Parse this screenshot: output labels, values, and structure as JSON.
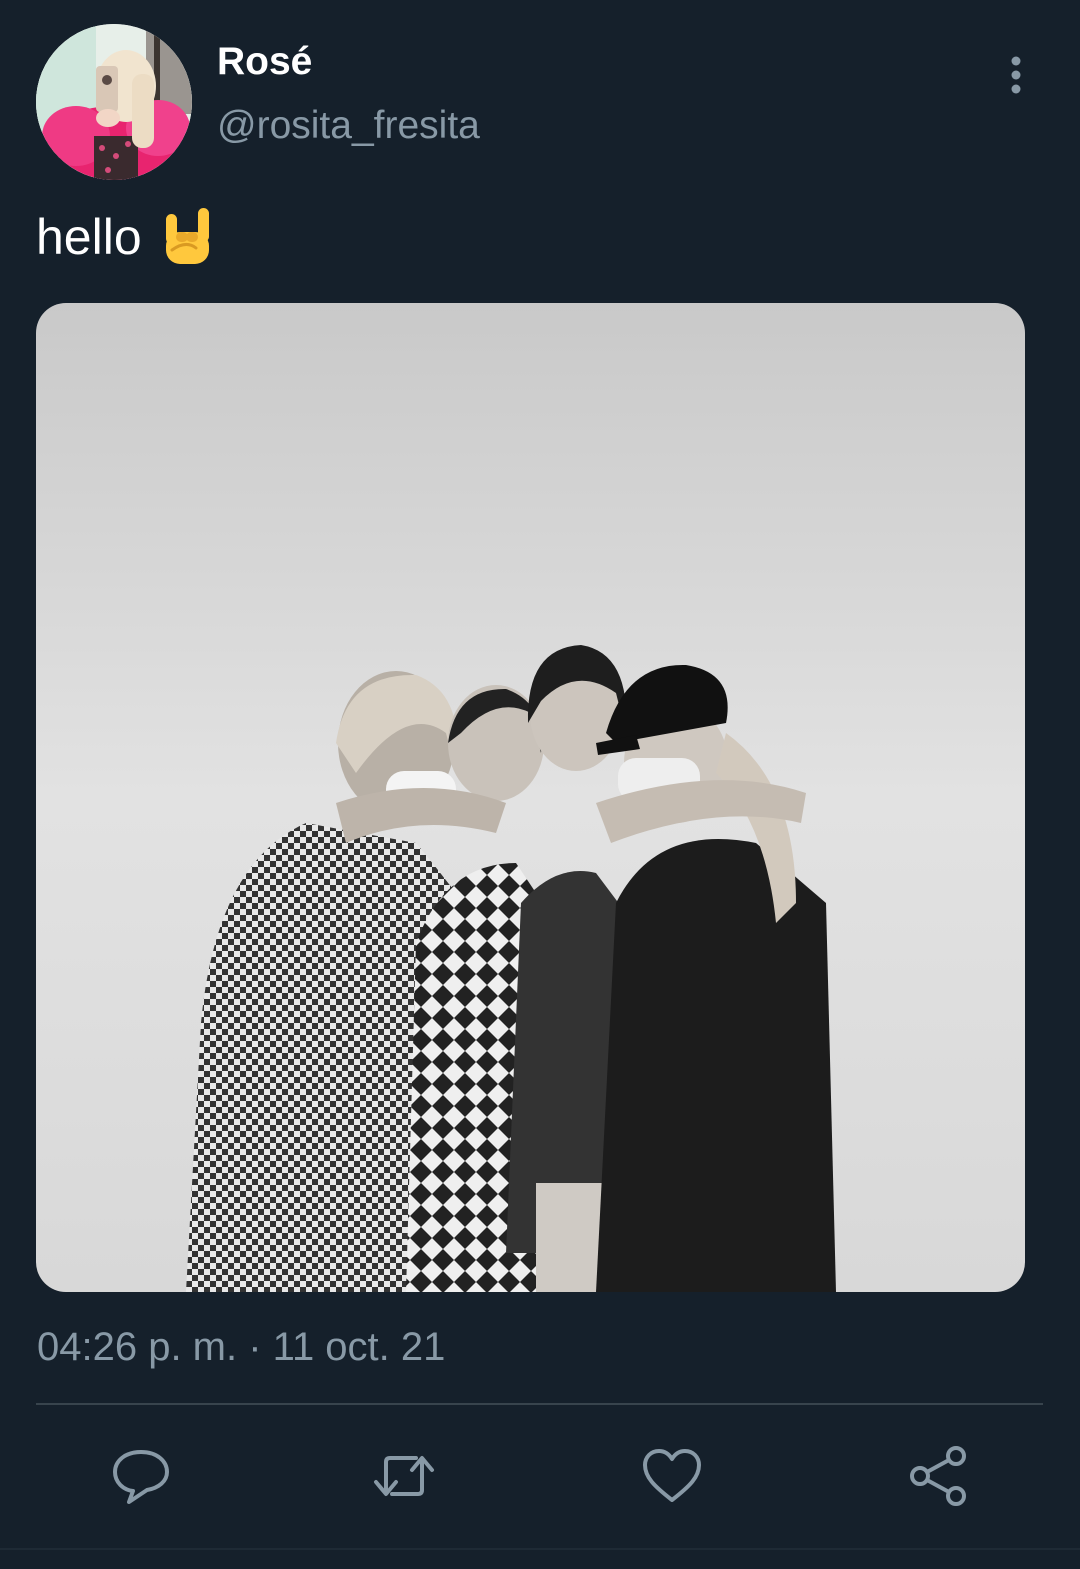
{
  "tweet": {
    "author": {
      "display_name": "Rosé",
      "handle": "@rosita_fresita",
      "avatar_icon": "profile-photo"
    },
    "text": "hello",
    "emoji": "🤘",
    "timestamp": "04:26 p. m. · 11 oct. 21"
  },
  "actions": [
    {
      "name": "reply",
      "icon": "reply-icon"
    },
    {
      "name": "retweet",
      "icon": "retweet-icon"
    },
    {
      "name": "like",
      "icon": "heart-icon"
    },
    {
      "name": "share",
      "icon": "share-icon"
    }
  ],
  "colors": {
    "background": "#15202b",
    "primary_text": "#ffffff",
    "secondary_text": "#8899a6",
    "divider": "#38444d",
    "action_icon": "#8899a6"
  }
}
